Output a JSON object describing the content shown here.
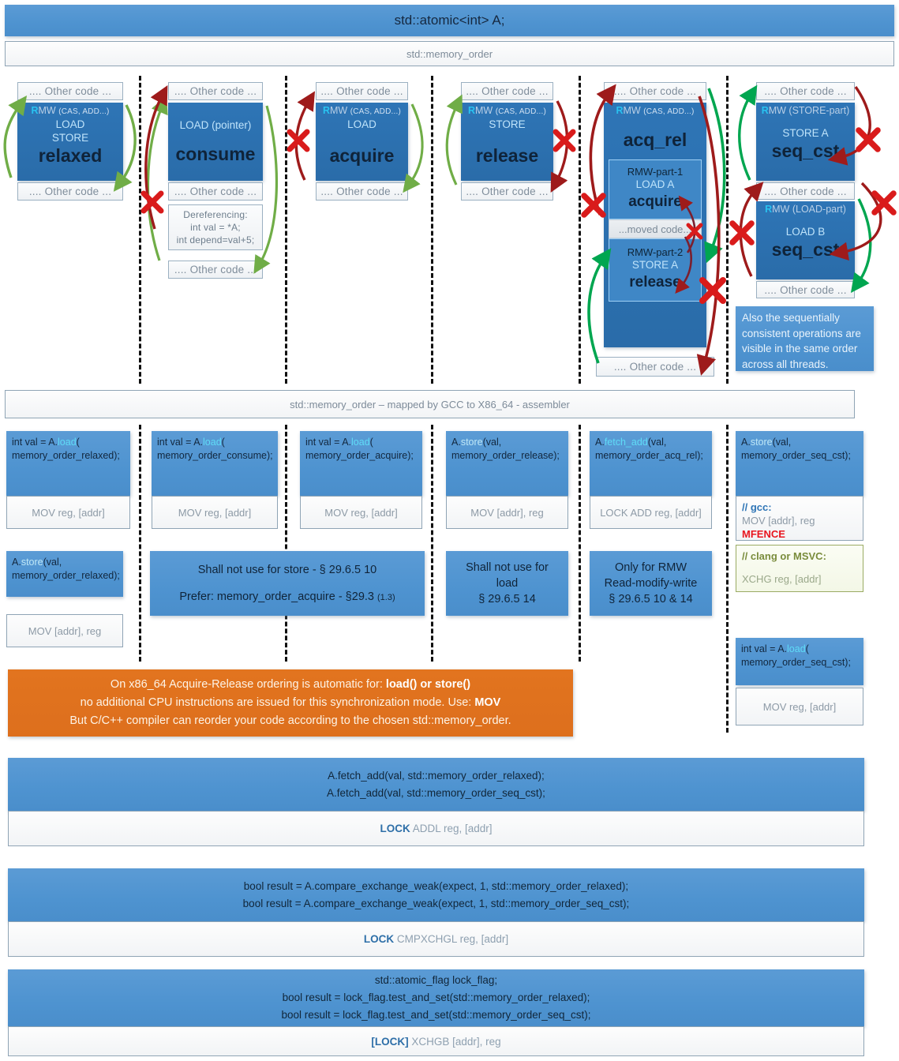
{
  "header": {
    "title": "std::atomic<int> A;",
    "subtitle": "std::memory_order",
    "asm_band": "std::memory_order – mapped by GCC  to X86_64 - assembler"
  },
  "labels": {
    "other_code": ".... Other code ...",
    "rmw_r": "R",
    "rmw_mw": "MW",
    "rmw_args": "(CAS, ADD...)",
    "moved_code": "...moved code..."
  },
  "columns": [
    {
      "id": "relaxed",
      "name": "relaxed",
      "rmw": "RMW (CAS, ADD...)",
      "ops": [
        "LOAD",
        "STORE"
      ],
      "code": {
        "line1": "int val = A.load(",
        "line2": "memory_order_relaxed);",
        "asm": "MOV reg, [addr]"
      },
      "code2": {
        "line1": "A.store(val,",
        "line2": "memory_order_relaxed);",
        "asm": "MOV [addr], reg"
      }
    },
    {
      "id": "consume",
      "name": "consume",
      "ops": [
        "LOAD (pointer)"
      ],
      "deref": [
        "Dereferencing:",
        "int val = *A;",
        "int depend=val+5;"
      ],
      "code": {
        "line1": "int val = A.load(",
        "line2": "memory_order_consume);",
        "asm": "MOV reg, [addr]"
      },
      "note": [
        "Shall not use for store - § 29.6.5  10",
        "Prefer: memory_order_acquire - §29.3",
        "(1.3)"
      ]
    },
    {
      "id": "acquire",
      "name": "acquire",
      "rmw": "RMW (CAS, ADD...)",
      "ops": [
        "LOAD"
      ],
      "code": {
        "line1": "int val = A.load(",
        "line2": "memory_order_acquire);",
        "asm": "MOV reg, [addr]"
      }
    },
    {
      "id": "release",
      "name": "release",
      "rmw": "RMW (CAS, ADD...)",
      "ops": [
        "STORE"
      ],
      "code": {
        "line1": "A.store(val,",
        "line2": "memory_order_release);",
        "asm": "MOV [addr], reg"
      },
      "note": [
        "Shall not use for",
        "load",
        "§ 29.6.5  14"
      ]
    },
    {
      "id": "acq_rel",
      "name": "acq_rel",
      "rmw": "RMW (CAS, ADD...)",
      "part1": [
        "RMW-part-1",
        "LOAD A",
        "acquire"
      ],
      "part2": [
        "RMW-part-2",
        "STORE A",
        "release"
      ],
      "code": {
        "line1": "A.fetch_add(val,",
        "line2": "memory_order_acq_rel);",
        "asm": "LOCK ADD reg, [addr]"
      },
      "note": [
        "Only for RMW",
        "Read-modify-write",
        "§ 29.6.5  10 & 14"
      ]
    },
    {
      "id": "seq_cst",
      "name": "seq_cst",
      "store_part": {
        "rmw": "RMW (STORE-part)",
        "op": "STORE A",
        "name": "seq_cst"
      },
      "load_part": {
        "rmw": "RMW (LOAD-part)",
        "op": "LOAD B",
        "name": "seq_cst"
      },
      "note_text": "Also the sequentially consistent operations are visible in the same order across all threads.",
      "code": {
        "line1": "A.store(val,",
        "line2": "memory_order_seq_cst);",
        "asm_gcc_cmt": "// gcc:",
        "asm_gcc_mov": "MOV [addr], reg",
        "asm_gcc_fence": "MFENCE",
        "asm_clang_cmt": "// clang or MSVC:",
        "asm_clang": "XCHG reg, [addr]"
      },
      "code2": {
        "line1": "int val = A.load(",
        "line2": "memory_order_seq_cst);",
        "asm": "MOV reg, [addr]"
      }
    }
  ],
  "banner": {
    "line1_a": "On x86_64 Acquire-Release ordering is automatic for: ",
    "line1_b": "load() or store()",
    "line2_a": "no additional CPU instructions are issued for this synchronization mode. Use: ",
    "line2_b": "MOV",
    "line3": "But C/C++ compiler can reorder your code according to the chosen std::memory_order."
  },
  "bottom_blocks": [
    {
      "id": "fetch-add",
      "lines": [
        "A.fetch_add(val, std::memory_order_relaxed);",
        "A.fetch_add(val, std::memory_order_seq_cst);"
      ],
      "asm_bold": "LOCK",
      "asm_rest": " ADDL reg, [addr]"
    },
    {
      "id": "compare-exchange",
      "lines": [
        "bool result = A.compare_exchange_weak(expect, 1, std::memory_order_relaxed);",
        "bool result = A.compare_exchange_weak(expect, 1, std::memory_order_seq_cst);"
      ],
      "asm_bold": "LOCK",
      "asm_rest": " CMPXCHGL reg, [addr]"
    },
    {
      "id": "atomic-flag",
      "lines": [
        "std::atomic_flag lock_flag;",
        "bool result = lock_flag.test_and_set(std::memory_order_relaxed);",
        "bool result = lock_flag.test_and_set(std::memory_order_seq_cst);"
      ],
      "asm_bold": "[LOCK]",
      "asm_rest": " XCHGB [addr], reg"
    }
  ],
  "colors": {
    "blue_fill": "#5b9bd5",
    "blue_dark": "#2e75b6",
    "orange": "#e2741f",
    "arrow_green": "#70ad47",
    "arrow_green_bright": "#00b050",
    "arrow_red": "#9e1b1b",
    "x_red": "#d91b1b",
    "cyan": "#29c2f0"
  }
}
